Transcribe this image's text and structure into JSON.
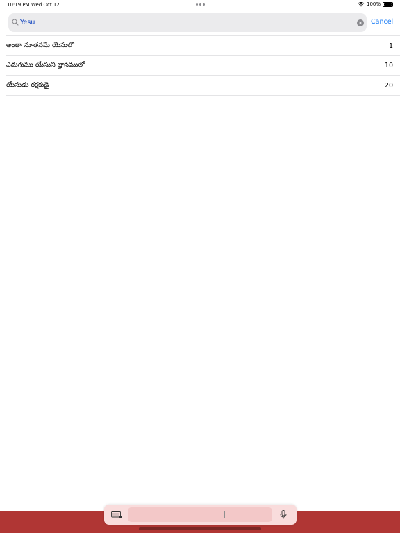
{
  "status_bar": {
    "time": "10:19 PM",
    "date": "Wed Oct 12",
    "battery": "100%"
  },
  "search": {
    "value": "Yesu",
    "cancel_label": "Cancel"
  },
  "results": [
    {
      "title": "అంతా నూతనమే యేసులో",
      "number": "1"
    },
    {
      "title": "ఎదుగుము యేసుని జ్ఞానములో",
      "number": "10"
    },
    {
      "title": "యేసుడు రక్షకుడై",
      "number": "20"
    }
  ],
  "colors": {
    "accent": "#1a7cf5",
    "search_text": "#0a3fbf",
    "bottom_band": "#b03634",
    "keyboard_bar": "#f9dcdc"
  }
}
